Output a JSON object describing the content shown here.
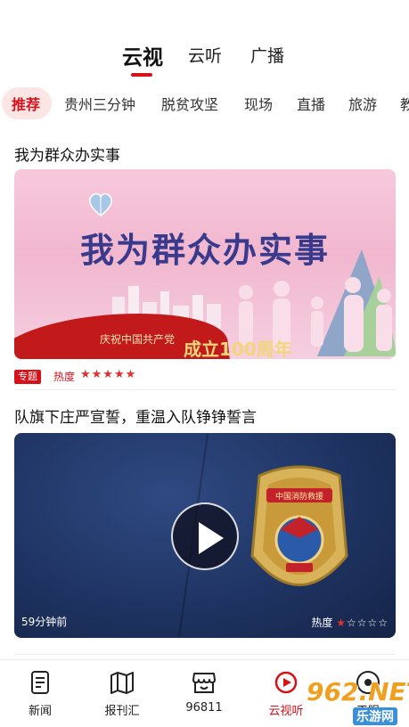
{
  "top_tabs": [
    {
      "label": "云视",
      "active": true
    },
    {
      "label": "云听",
      "active": false
    },
    {
      "label": "广播",
      "active": false
    }
  ],
  "categories": [
    {
      "label": "推荐",
      "active": true
    },
    {
      "label": "贵州三分钟"
    },
    {
      "label": "脱贫攻坚"
    },
    {
      "label": "现场"
    },
    {
      "label": "直播"
    },
    {
      "label": "旅游"
    },
    {
      "label": "教"
    }
  ],
  "feed": [
    {
      "title": "我为群众办实事",
      "image_headline": "我为群众办实事",
      "image_caption_small": "庆祝中国共产党",
      "image_caption_big": "成立100周年",
      "tag": "专题",
      "heat_label": "热度",
      "heat_stars": 5,
      "heat_max": 5
    },
    {
      "title": "队旗下庄严宣誓，重温入队铮铮誓言",
      "time": "59分钟前",
      "heat_label": "热度",
      "heat_stars": 1,
      "heat_max": 5,
      "badge_text": "中国消防救援"
    }
  ],
  "bottom_nav": [
    {
      "label": "新闻",
      "icon": "news-icon",
      "active": false
    },
    {
      "label": "报刊汇",
      "icon": "map-icon",
      "active": false
    },
    {
      "label": "96811",
      "icon": "store-icon",
      "active": false
    },
    {
      "label": "云视听",
      "icon": "video-icon",
      "active": true
    },
    {
      "label": "天眼",
      "icon": "eye-icon",
      "active": false
    }
  ],
  "watermark": {
    "text": "962.NET",
    "sub": "乐游网"
  },
  "colors": {
    "accent": "#d6111a",
    "pill_bg": "#fbe5e5"
  }
}
